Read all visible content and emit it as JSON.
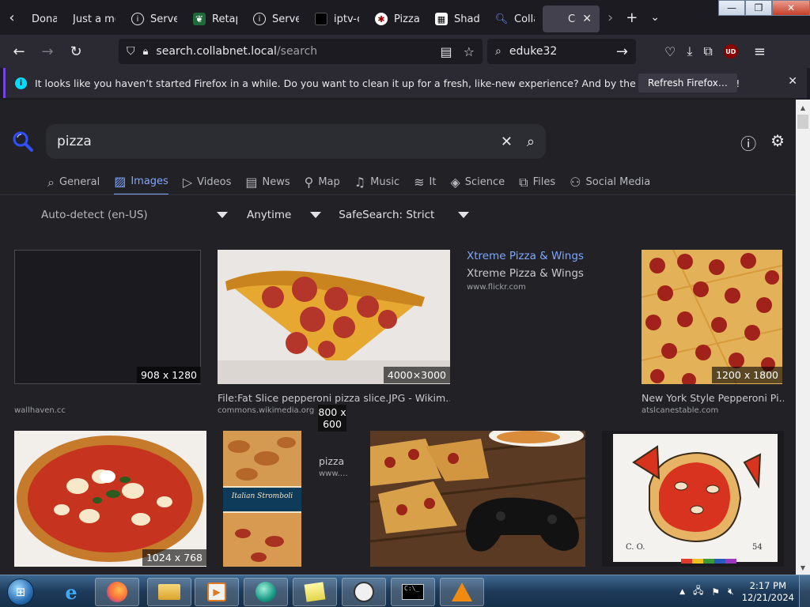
{
  "browser": {
    "tabs": [
      {
        "label": "Donat",
        "favicon": "blank-icon"
      },
      {
        "label": "Just a mo",
        "favicon": "blank-icon"
      },
      {
        "label": "Server",
        "favicon": "info-icon"
      },
      {
        "label": "Retap",
        "favicon": "leaf-icon"
      },
      {
        "label": "Server",
        "favicon": "info-icon"
      },
      {
        "label": "iptv-o",
        "favicon": "square-icon"
      },
      {
        "label": "Pizza_",
        "favicon": "wikimedia-icon"
      },
      {
        "label": "Shado",
        "favicon": "shadow-icon"
      },
      {
        "label": "Collab",
        "favicon": "search-icon"
      },
      {
        "label": "Co",
        "favicon": "blank-icon",
        "active": true
      }
    ],
    "url_host": "search.collabnet.local",
    "url_path": "/search",
    "search_box_value": "eduke32",
    "ublock_label": "UD"
  },
  "notification": {
    "message": "It looks like you haven’t started Firefox in a while. Do you want to clean it up for a fresh, like-new experience? And by the way, welcome back!",
    "button": "Refresh Firefox…"
  },
  "searx": {
    "query": "pizza",
    "categories": [
      {
        "label": "General",
        "icon": "search-icon"
      },
      {
        "label": "Images",
        "icon": "image-icon",
        "active": true
      },
      {
        "label": "Videos",
        "icon": "play-icon"
      },
      {
        "label": "News",
        "icon": "newspaper-icon"
      },
      {
        "label": "Map",
        "icon": "map-pin-icon"
      },
      {
        "label": "Music",
        "icon": "music-icon"
      },
      {
        "label": "It",
        "icon": "layers-icon"
      },
      {
        "label": "Science",
        "icon": "graduation-icon"
      },
      {
        "label": "Files",
        "icon": "files-icon"
      },
      {
        "label": "Social Media",
        "icon": "people-icon"
      }
    ],
    "filters": {
      "language": "Auto-detect (en-US)",
      "time": "Anytime",
      "safesearch": "SafeSearch: Strict"
    },
    "results_row1": [
      {
        "dims": "908 x 1280",
        "title": "",
        "url": "wallhaven.cc"
      },
      {
        "dims": "4000×3000",
        "title": "File:Fat Slice pepperoni pizza slice.JPG - Wikim…",
        "url": "commons.wikimedia.org"
      },
      {
        "dims": "",
        "title": "Xtreme Pizza & Wings",
        "title2": "Xtreme Pizza & Wings",
        "url": "www.flickr.com"
      },
      {
        "dims": "1200 x 1800",
        "title": "New York Style Pepperoni Pi…",
        "url": "atslcanestable.com"
      }
    ],
    "results_row2": [
      {
        "dims": "1024 x 768",
        "title": "",
        "url": ""
      },
      {
        "dims": "",
        "title": "",
        "url": ""
      },
      {
        "dims": "800 x 600",
        "title": "pizza",
        "url": "www.…"
      },
      {
        "dims": "",
        "title": "",
        "url": ""
      },
      {
        "dims": "",
        "title": "",
        "url": ""
      }
    ]
  },
  "taskbar": {
    "time": "2:17 PM",
    "date": "12/21/2024"
  }
}
